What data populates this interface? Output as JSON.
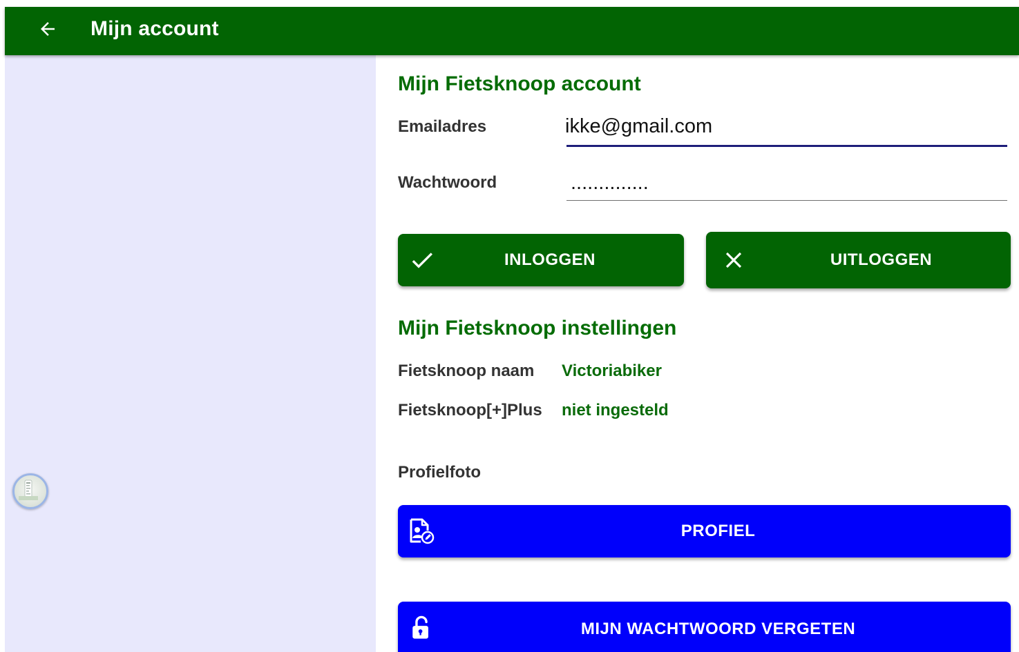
{
  "header": {
    "title": "Mijn account",
    "back_icon": "arrow-left-icon"
  },
  "colors": {
    "appbar": "#026403",
    "green_text": "#056c05",
    "blue_button": "#0000fb",
    "left_pane": "#e8e8fc"
  },
  "account": {
    "section_title": "Mijn Fietsknoop account",
    "email_label": "Emailadres",
    "email_value": "ikke@gmail.com",
    "password_label": "Wachtwoord",
    "password_value": "..............",
    "login_button": "INLOGGEN",
    "logout_button": "UITLOGGEN"
  },
  "settings": {
    "section_title": "Mijn Fietsknoop instellingen",
    "name_label": "Fietsknoop naam",
    "name_value": "Victoriabiker",
    "plus_label": "Fietsknoop[+]Plus",
    "plus_value": "niet ingesteld",
    "photo_label": "Profielfoto",
    "profile_button": "PROFIEL",
    "forgot_button": "MIJN WACHTWOORD VERGETEN"
  },
  "icons": {
    "login": "check-icon",
    "logout": "close-icon",
    "profile": "profile-edit-icon",
    "forgot": "unlock-icon",
    "floating": "floating-avatar-icon"
  }
}
